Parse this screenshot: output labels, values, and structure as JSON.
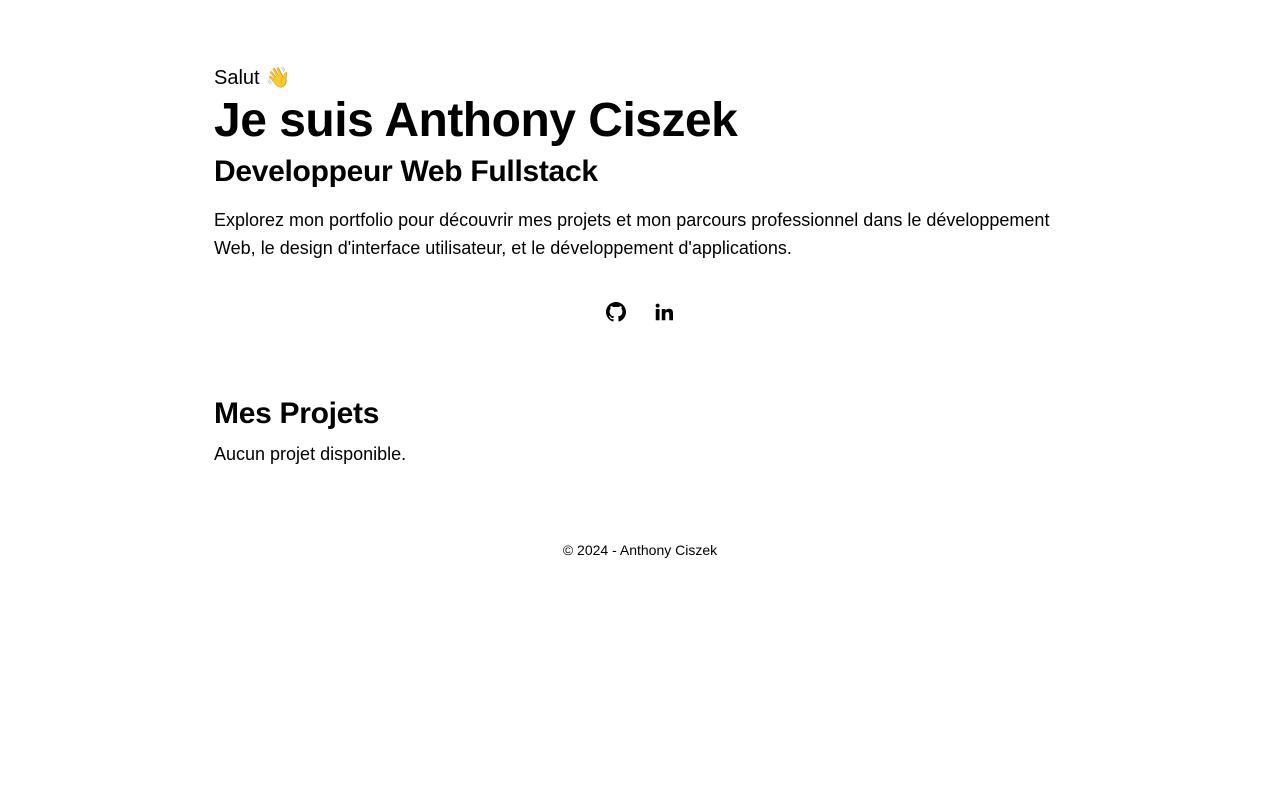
{
  "hero": {
    "greeting": "Salut",
    "wave_emoji": "👋",
    "title": "Je suis Anthony Ciszek",
    "subtitle": "Developpeur Web Fullstack",
    "intro": "Explorez mon portfolio pour découvrir mes projets et mon parcours professionnel dans le développement Web, le design d'interface utilisateur, et le développement d'applications."
  },
  "socials": [
    {
      "icon": "github-icon"
    },
    {
      "icon": "linkedin-icon"
    }
  ],
  "projects": {
    "title": "Mes Projets",
    "empty_message": "Aucun projet disponible."
  },
  "footer": {
    "text": "© 2024 - Anthony Ciszek"
  }
}
